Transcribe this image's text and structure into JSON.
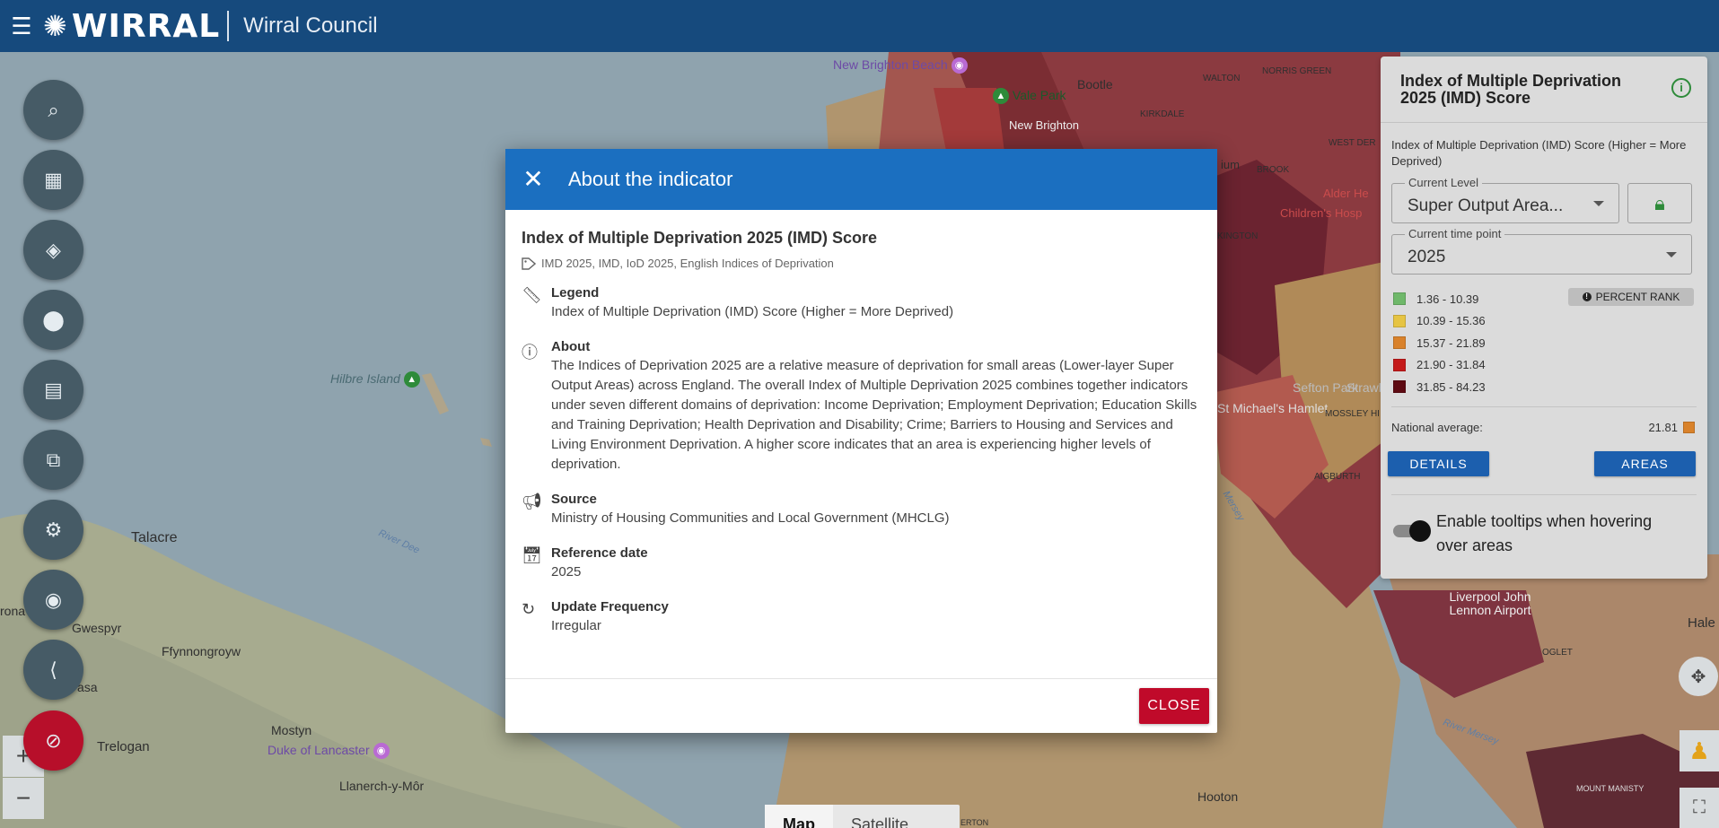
{
  "header": {
    "menu_icon": "menu-icon",
    "logo_text": "WIRRAL",
    "council_name": "Wirral Council"
  },
  "map": {
    "labels": {
      "new_brighton_beach": "New Brighton Beach",
      "bootle": "Bootle",
      "walton": "WALTON",
      "kirkdale": "KIRKDALE",
      "norris_green": "NORRIS GREEN",
      "vale_park": "Vale Park",
      "new_brighton": "New Brighton",
      "hilbre_island": "Hilbre Island",
      "talacre": "Talacre",
      "river_dee": "River Dee",
      "gwespyr": "Gwespyr",
      "ffynnongroyw": "Ffynnongroyw",
      "asa": "asa",
      "rona": "rona",
      "mostyn": "Mostyn",
      "duke_of_lancaster": "Duke of Lancaster",
      "trelogan": "Trelogan",
      "llanerch": "Llanerch-y-Môr",
      "liverpool_airport": "Liverpool John Lennon Airport",
      "hale": "Hale",
      "river_mersey": "River Mersey",
      "hooton": "Hooton",
      "oglet": "OGLET",
      "mount_manisty": "MOUNT MANISTY",
      "sefton_park": "Sefton Park",
      "strawberry": "Strawber",
      "michaels_hamlet": "St Michael's Hamlet",
      "mossley_hill": "MOSSLEY HI",
      "aigburth": "AIGBURTH",
      "childrens_hosp": "Children's Hosp",
      "alder_hey": "Alder He",
      "west_derby": "WEST DER",
      "erton": "ERTON",
      "brook": "BROOK",
      "ium": "ium",
      "kington": "KINGTON",
      "mersey": "Mersey"
    },
    "map_type": {
      "map": "Map",
      "satellite": "Satellite"
    }
  },
  "left_tools": [
    {
      "name": "map-search-icon",
      "glyph": "⌕"
    },
    {
      "name": "dashboard-icon",
      "glyph": "▦"
    },
    {
      "name": "layers-add-icon",
      "glyph": "◈"
    },
    {
      "name": "location-pin-icon",
      "glyph": "⬤"
    },
    {
      "name": "report-icon",
      "glyph": "▤"
    },
    {
      "name": "compare-areas-icon",
      "glyph": "⧉"
    },
    {
      "name": "settings-icon",
      "glyph": "⚙"
    },
    {
      "name": "camera-icon",
      "glyph": "◉"
    },
    {
      "name": "share-icon",
      "glyph": "⟨"
    },
    {
      "name": "layers-off-icon",
      "glyph": "⊘"
    }
  ],
  "zoom": {
    "in": "+",
    "out": "−"
  },
  "panel": {
    "title": "Index of Multiple Deprivation 2025 (IMD) Score",
    "info_icon": "info-icon",
    "description": "Index of Multiple Deprivation (IMD) Score (Higher = More Deprived)",
    "level_label": "Current Level",
    "level_value": "Super Output Area...",
    "time_label": "Current time point",
    "time_value": "2025",
    "percent_rank_label": "PERCENT RANK",
    "legend": [
      {
        "range": "1.36 - 10.39",
        "color": "#6fb86a"
      },
      {
        "range": "10.39 - 15.36",
        "color": "#e6c443"
      },
      {
        "range": "15.37 - 21.89",
        "color": "#d9822b"
      },
      {
        "range": "21.90 - 31.84",
        "color": "#c41a1a"
      },
      {
        "range": "31.85 - 84.23",
        "color": "#5e0a12"
      }
    ],
    "national_average_label": "National average:",
    "national_average_value": "21.81",
    "national_average_color": "#d9822b",
    "details_label": "DETAILS",
    "areas_label": "AREAS",
    "tooltip_toggle_label": "Enable tooltips when hovering over areas"
  },
  "dialog": {
    "header_title": "About the indicator",
    "indicator_title": "Index of Multiple Deprivation 2025 (IMD) Score",
    "tags": "IMD 2025, IMD, IoD 2025, English Indices of Deprivation",
    "sections": {
      "legend": {
        "title": "Legend",
        "text": "Index of Multiple Deprivation (IMD) Score (Higher = More Deprived)"
      },
      "about": {
        "title": "About",
        "text": "The Indices of Deprivation 2025 are a relative measure of deprivation for small areas (Lower-layer Super Output Areas) across England. The overall Index of Multiple Deprivation 2025 combines together indicators under seven different domains of deprivation: Income Deprivation; Employment Deprivation; Education Skills and Training Deprivation; Health Deprivation and Disability; Crime; Barriers to Housing and Services and Living Environment Deprivation. A higher score indicates that an area is experiencing higher levels of deprivation."
      },
      "source": {
        "title": "Source",
        "text": "Ministry of Housing Communities and Local Government (MHCLG)"
      },
      "reference_date": {
        "title": "Reference date",
        "text": "2025"
      },
      "update_frequency": {
        "title": "Update Frequency",
        "text": "Irregular"
      }
    },
    "close_label": "CLOSE"
  }
}
